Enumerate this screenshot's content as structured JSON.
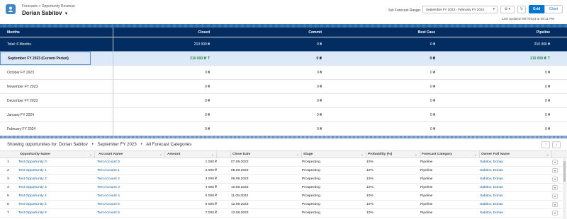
{
  "header": {
    "breadcrumb": "Forecasts > Opportunity Revenue",
    "user_name": "Dorian Sabitov",
    "range_label": "Set Forecast Range:",
    "range_value": "September FY 2023 - February FY 2024",
    "grid_label": "Grid",
    "chart_label": "Chart",
    "last_updated": "Last updated 09/7/2023 at 08:11 PM"
  },
  "forecast": {
    "columns": [
      "Months",
      "Closed",
      "Commit",
      "Best Case",
      "Pipeline"
    ],
    "total": {
      "label": "Total: 6 Months",
      "closed": "210 000 ₴",
      "commit": "0 ₴",
      "best": "0 ₴",
      "pipeline": "210 000 ₴"
    },
    "current": {
      "label": "September FY 2023 (Current Period)",
      "closed": "210 000 ₴",
      "commit": "0 ₴",
      "best": "0 ₴",
      "pipeline": "210 000 ₴"
    },
    "rows": [
      {
        "label": "October FY 2023",
        "closed": "0 ₴",
        "commit": "0 ₴",
        "best": "0 ₴",
        "pipeline": "0 ₴"
      },
      {
        "label": "November FY 2023",
        "closed": "0 ₴",
        "commit": "0 ₴",
        "best": "0 ₴",
        "pipeline": "0 ₴"
      },
      {
        "label": "December FY 2023",
        "closed": "0 ₴",
        "commit": "0 ₴",
        "best": "0 ₴",
        "pipeline": "0 ₴"
      },
      {
        "label": "January FY 2024",
        "closed": "0 ₴",
        "commit": "0 ₴",
        "best": "0 ₴",
        "pipeline": "0 ₴"
      },
      {
        "label": "February FY 2024",
        "closed": "0 ₴",
        "commit": "0 ₴",
        "best": "0 ₴",
        "pipeline": "0 ₴"
      }
    ]
  },
  "opportunities": {
    "title_prefix": "Showing opportunities for: Dorian Sabitov",
    "title_period": "September FY 2023",
    "title_category": "All Forecast Categories",
    "bullet": "•",
    "columns": [
      "Opportunity Name",
      "Account Name",
      "Amount",
      "Close Date",
      "Stage",
      "Probability (%)",
      "Forecast Category",
      "Owner Full Name"
    ],
    "rows": [
      {
        "n": "1",
        "name": "Test Opportunity 0",
        "account": "Test Account 0",
        "amount": "1 000 ₴",
        "date": "07.09.2023",
        "stage": "Prospecting",
        "prob": "10%",
        "cat": "Pipeline",
        "owner": "Sabitov, Dorian"
      },
      {
        "n": "2",
        "name": "Test Opportunity 1",
        "account": "Test Account 1",
        "amount": "2 000 ₴",
        "date": "08.09.2023",
        "stage": "Prospecting",
        "prob": "10%",
        "cat": "Pipeline",
        "owner": "Sabitov, Dorian"
      },
      {
        "n": "3",
        "name": "Test Opportunity 2",
        "account": "Test Account 2",
        "amount": "3 000 ₴",
        "date": "09.09.2023",
        "stage": "Prospecting",
        "prob": "10%",
        "cat": "Pipeline",
        "owner": "Sabitov, Dorian"
      },
      {
        "n": "4",
        "name": "Test Opportunity 3",
        "account": "Test Account 3",
        "amount": "4 000 ₴",
        "date": "10.09.2023",
        "stage": "Prospecting",
        "prob": "10%",
        "cat": "Pipeline",
        "owner": "Sabitov, Dorian"
      },
      {
        "n": "5",
        "name": "Test Opportunity 4",
        "account": "Test Account 4",
        "amount": "5 000 ₴",
        "date": "11.09.2023",
        "stage": "Prospecting",
        "prob": "10%",
        "cat": "Pipeline",
        "owner": "Sabitov, Dorian"
      },
      {
        "n": "6",
        "name": "Test Opportunity 5",
        "account": "Test Account 5",
        "amount": "6 000 ₴",
        "date": "12.09.2023",
        "stage": "Prospecting",
        "prob": "10%",
        "cat": "Pipeline",
        "owner": "Sabitov, Dorian"
      },
      {
        "n": "7",
        "name": "Test Opportunity 6",
        "account": "Test Account 6",
        "amount": "7 000 ₴",
        "date": "13.09.2023",
        "stage": "Prospecting",
        "prob": "10%",
        "cat": "Pipeline",
        "owner": "Sabitov, Dorian"
      }
    ]
  },
  "colors": {
    "header_navy": "#032d60",
    "brand_blue": "#0176d3",
    "link": "#0b5cab",
    "positive": "#2e844a",
    "current_row": "#dce9f8"
  }
}
